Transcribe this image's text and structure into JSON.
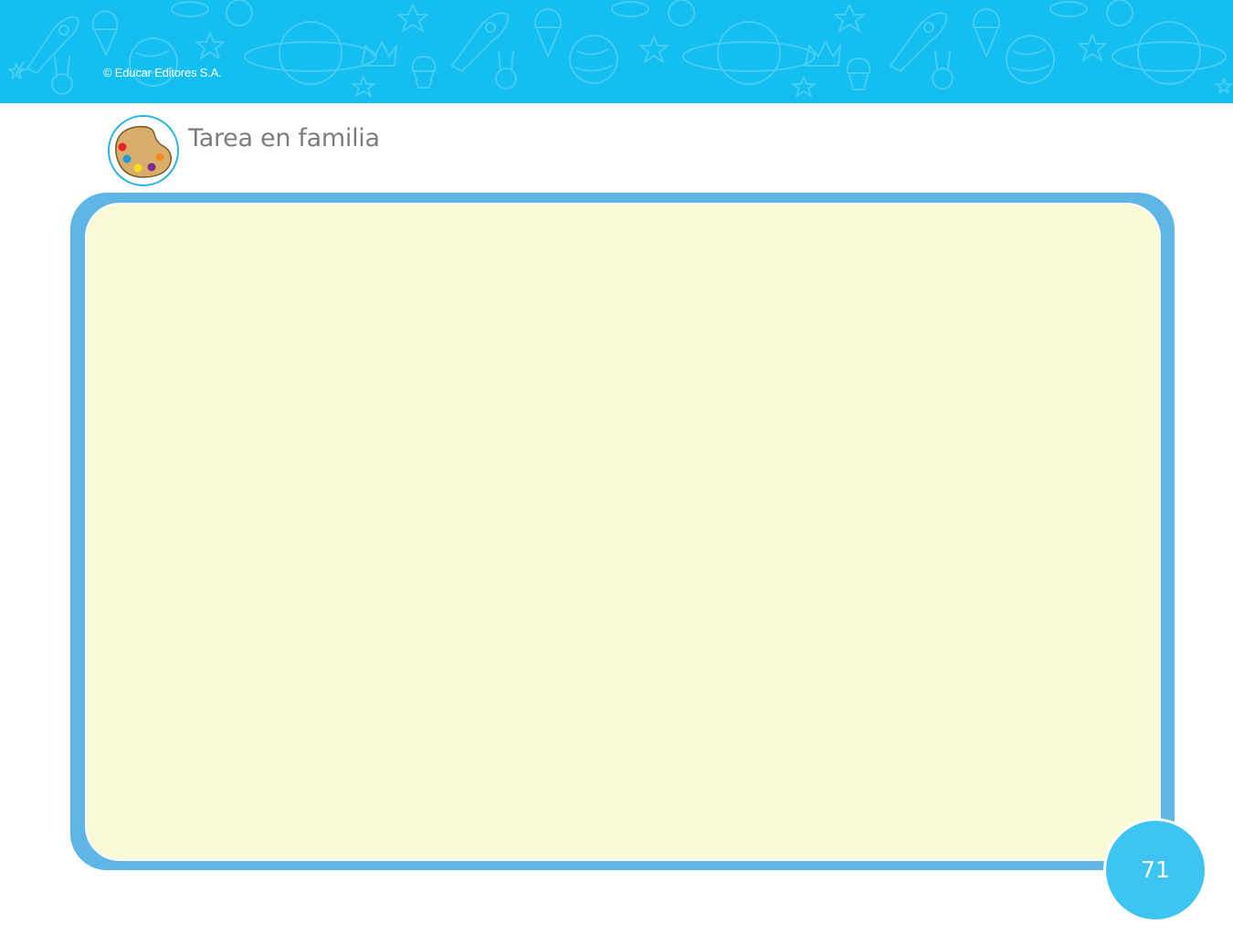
{
  "header": {
    "copyright": "© Educar Editores S.A.",
    "banner_color": "#14bef0",
    "pattern_icons": [
      "rocket-icon",
      "ice-cream-icon",
      "planet-icon",
      "star-icon",
      "bunny-icon",
      "cupcake-icon",
      "crown-icon",
      "globe-icon"
    ]
  },
  "section": {
    "title": "Tarea en familia",
    "icon": "paint-palette-icon",
    "palette_colors": [
      "#e5202a",
      "#1d9ad8",
      "#f6e01a",
      "#7b2c8d",
      "#f28c1e"
    ]
  },
  "content_area": {
    "frame_color": "#5fb6e6",
    "fill_color": "#fafad7"
  },
  "footer": {
    "page_number": "71",
    "badge_color": "#3ec4f3"
  }
}
